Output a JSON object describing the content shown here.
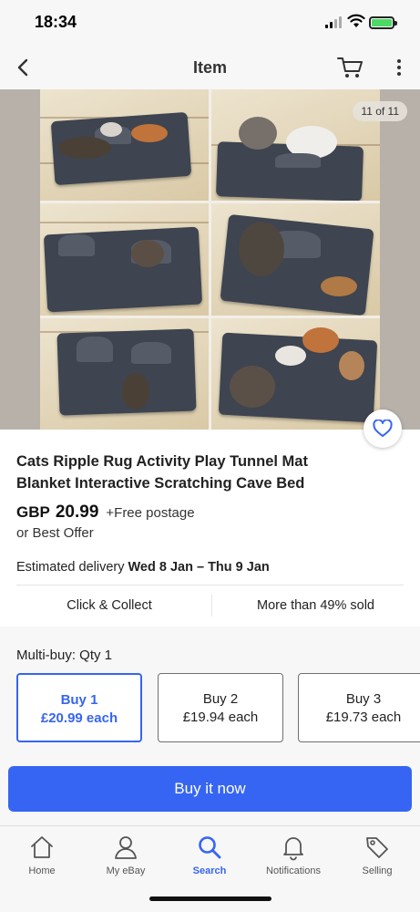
{
  "status_bar": {
    "time": "18:34"
  },
  "nav": {
    "title": "Item"
  },
  "gallery": {
    "counter": "11 of 11"
  },
  "product": {
    "title": "Cats Ripple Rug Activity Play Tunnel Mat Blanket Interactive Scratching Cave Bed",
    "currency": "GBP",
    "price": "20.99",
    "postage": "+Free postage",
    "best_offer": "or Best Offer",
    "delivery_label": "Estimated delivery",
    "delivery_dates": "Wed 8 Jan – Thu 9 Jan",
    "click_collect": "Click & Collect",
    "sold": "More than 49% sold"
  },
  "multibuy": {
    "label": "Multi-buy: Qty 1",
    "options": [
      {
        "line1": "Buy 1",
        "line2": "£20.99 each",
        "selected": true
      },
      {
        "line1": "Buy 2",
        "line2": "£19.94 each",
        "selected": false
      },
      {
        "line1": "Buy 3",
        "line2": "£19.73 each",
        "selected": false
      }
    ]
  },
  "actions": {
    "buy_now": "Buy it now"
  },
  "tabs": [
    {
      "label": "Home",
      "icon": "home-icon"
    },
    {
      "label": "My eBay",
      "icon": "person-icon"
    },
    {
      "label": "Search",
      "icon": "search-icon",
      "active": true
    },
    {
      "label": "Notifications",
      "icon": "bell-icon"
    },
    {
      "label": "Selling",
      "icon": "tag-icon"
    }
  ],
  "colors": {
    "accent": "#3665f3",
    "text": "#191919",
    "background": "#f7f7f7"
  }
}
